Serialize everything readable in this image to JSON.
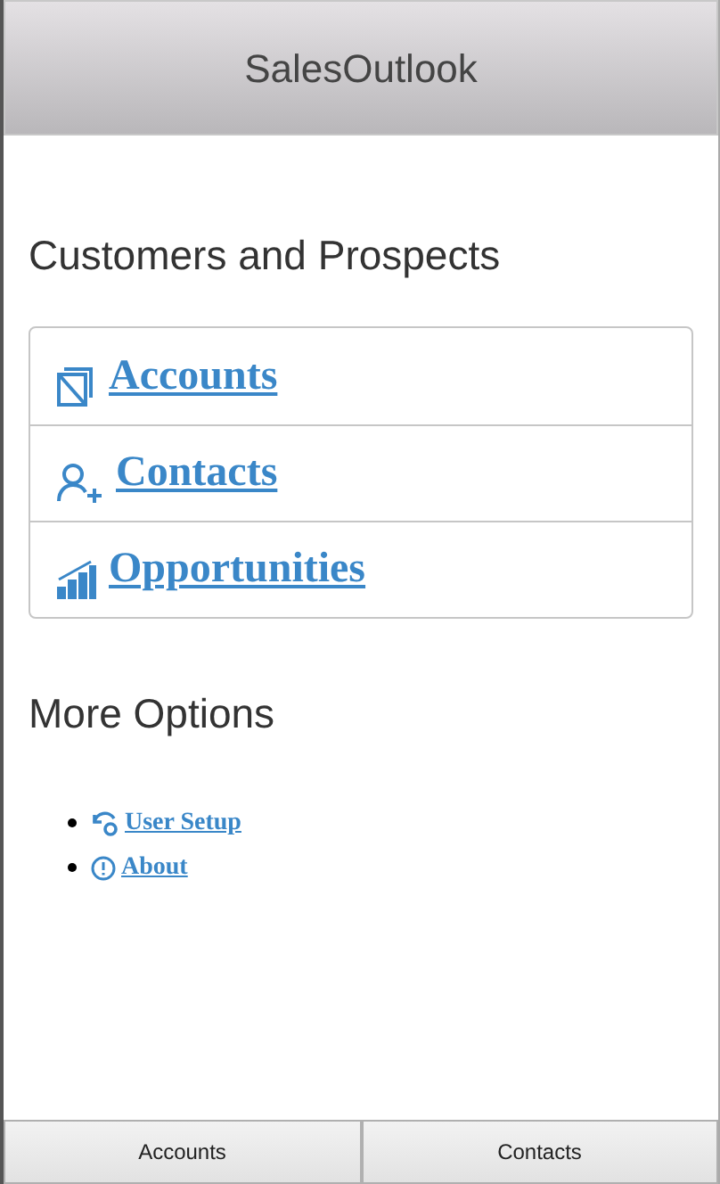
{
  "header": {
    "title": "SalesOutlook"
  },
  "sections": [
    {
      "heading": "Customers and Prospects",
      "links": [
        {
          "kind": "accounts",
          "label": "Accounts"
        },
        {
          "kind": "contacts",
          "label": "Contacts"
        },
        {
          "kind": "opportunities",
          "label": "Opportunities"
        }
      ]
    }
  ],
  "more_options": {
    "heading": "More Options",
    "items": [
      {
        "kind": "setup",
        "label": "User Setup"
      },
      {
        "kind": "about",
        "label": "About"
      }
    ]
  },
  "tab_bar": [
    {
      "label": "Accounts"
    },
    {
      "label": "Contacts"
    }
  ]
}
